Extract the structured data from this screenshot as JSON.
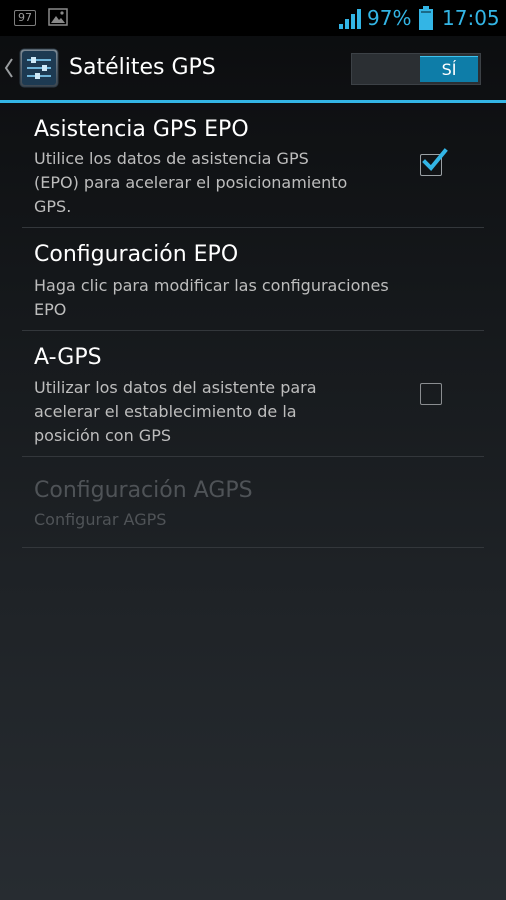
{
  "status_bar": {
    "notification_badge": "97",
    "notification_icon": "image-icon",
    "signal_icon": "signal-bars-icon",
    "battery_percent": "97%",
    "battery_icon": "battery-icon",
    "time": "17:05",
    "accent_color": "#33b5e5"
  },
  "action_bar": {
    "back_icon": "chevron-left-icon",
    "app_icon": "sliders-settings-icon",
    "title": "Satélites GPS",
    "switch": {
      "state": "on",
      "label": "SÍ"
    }
  },
  "preferences": [
    {
      "title": "Asistencia GPS EPO",
      "summary": [
        "Utilice los datos de asistencia GPS",
        "(EPO) para acelerar el posicionamiento",
        "GPS."
      ],
      "widget": "checkbox",
      "checked": true,
      "enabled": true
    },
    {
      "title": "Configuración EPO",
      "summary": [
        "Haga clic para modificar las configuraciones",
        "EPO"
      ],
      "widget": "none",
      "enabled": true
    },
    {
      "title": "A-GPS",
      "summary": [
        "Utilizar los datos del asistente para",
        "acelerar el establecimiento de la",
        "posición con GPS"
      ],
      "widget": "checkbox",
      "checked": false,
      "enabled": true
    },
    {
      "title": "Configuración AGPS",
      "summary": [
        "Configurar AGPS"
      ],
      "widget": "none",
      "enabled": false
    }
  ]
}
